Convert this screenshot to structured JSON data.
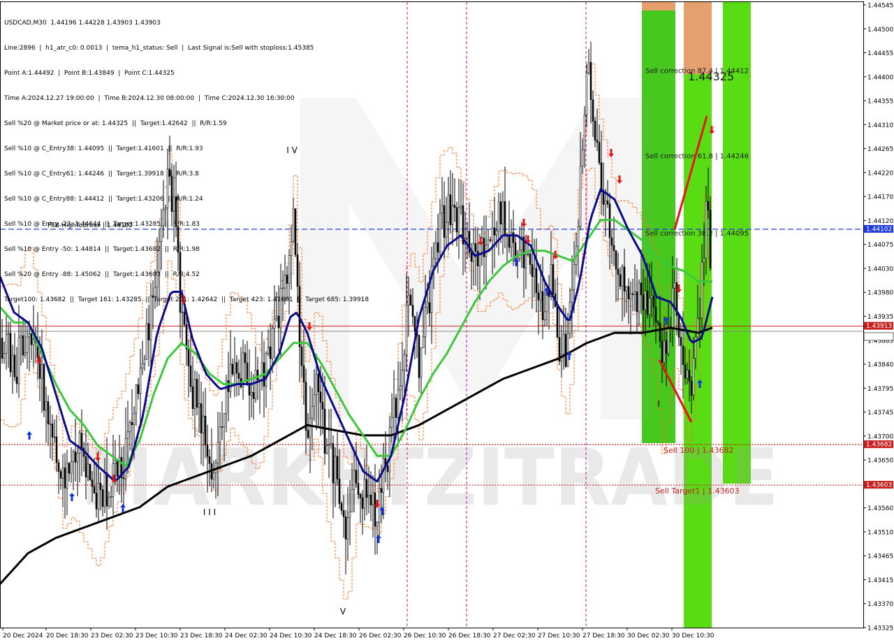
{
  "info": {
    "lines": [
      "USDCAD,M30  1.44196 1.44228 1.43903 1.43903",
      "Line:2896  |  h1_atr_c0: 0.0013  |  tema_h1_status: Sell  |  Last Signal is:Sell with stoploss:1.45385",
      "Point A:1.44492  |  Point B:1.43849  |  Point C:1.44325",
      "Time A:2024.12.27 19:00:00  |  Time B:2024.12.30 08:00:00  |  Time C:2024.12.30 16:30:00",
      "Sell %20 @ Market price or at: 1.44325  ||  Target:1.42642  ||  R/R:1.59",
      "Sell %10 @ C_Entry38: 1.44095  ||  Target:1.41601  ||  R/R:1.93",
      "Sell %10 @ C_Entry61: 1.44246  ||  Target:1.39918  ||  R/R:3.8",
      "Sell %10 @ C_Entry88: 1.44412  ||  Target:1.43206  ||  R/R:1.24",
      "Sell %10 @ Entry -23: 1.44644  ||  Target:1.43285  ||  R/R:1.83",
      "Sell %10 @ Entry -50: 1.44814  ||  Target:1.43682  ||  R/R:1.98",
      "Sell %20 @ Entry -88: 1.45062  ||  Target:1.43603  ||  R/R:4.52",
      "Target100: 1.43682  ||  Target 161: 1.43285  ||  Target 261: 1.42642  ||  Target 423: 1.41601  ||  Target 685: 1.39918"
    ]
  },
  "chart_data": {
    "type": "candlestick",
    "symbol": "USDCAD",
    "timeframe": "M30",
    "ylim": [
      1.43325,
      1.44545
    ],
    "y_ticks": [
      "1.44545",
      "1.44500",
      "1.44455",
      "1.44400",
      "1.44355",
      "1.44310",
      "1.44265",
      "1.44220",
      "1.44170",
      "1.44120",
      "1.44075",
      "1.44030",
      "1.43980",
      "1.43935",
      "1.43885",
      "1.43840",
      "1.43795",
      "1.43745",
      "1.43700",
      "1.43650",
      "1.43605",
      "1.43560",
      "1.43510",
      "1.43465",
      "1.43415",
      "1.43370",
      "1.43325"
    ],
    "x_ticks": [
      "20 Dec 2024",
      "20 Dec 18:30",
      "23 Dec 02:30",
      "23 Dec 10:30",
      "23 Dec 18:30",
      "24 Dec 02:30",
      "24 Dec 10:30",
      "24 Dec 18:30",
      "26 Dec 02:30",
      "26 Dec 10:30",
      "26 Dec 18:30",
      "27 Dec 02:30",
      "27 Dec 10:30",
      "27 Dec 18:30",
      "30 Dec 02:30",
      "30 Dec 10:30"
    ],
    "background": "#ffffff",
    "watermark": "MARKETZITRADE",
    "horizontal_lines": [
      {
        "label": "FSB-HighToBreak  |  1.44102",
        "value": 1.44102,
        "tag": "1.44102",
        "color": "#1e3cdc",
        "style": "dashed"
      },
      {
        "value": 1.43913,
        "tag": "1.43913",
        "color": "#c81e1e",
        "style": "solid"
      },
      {
        "value": 1.43903,
        "tag": "1.43903",
        "color": "#888888",
        "style": "solid"
      },
      {
        "label": "Sell 100  |  1.43682",
        "value": 1.43682,
        "tag": "1.43682",
        "color": "#c81e1e",
        "style": "dotted"
      },
      {
        "label": "Sell Target1  |  1.43603",
        "value": 1.43603,
        "tag": "1.43603",
        "color": "#c81e1e",
        "style": "dotted"
      }
    ],
    "zone_labels": [
      {
        "text": "Sell correction 87.4  |  1.44412",
        "value": 1.44412
      },
      {
        "text": "Sell correction 61.8  |  1.44246",
        "value": 1.44246
      },
      {
        "text": "Sell correction 38.2  |  1.44095",
        "value": 1.44095
      }
    ],
    "big_label": "1.44325",
    "wave_labels": [
      "I V",
      "I I I",
      "V",
      "I"
    ],
    "colors": {
      "candle": "#000000",
      "ma_fast": "#0a0a8c",
      "ma_mid": "#3cc83c",
      "ma_slow": "#000000",
      "envelope": "#ff6a1a",
      "zone_green": "#46c81e",
      "zone_lime": "#5adc14",
      "zone_orange": "#e6a06e",
      "vline": "#c8148c",
      "arrow_sell": "#e61414",
      "arrow_buy": "#1432dc"
    },
    "series": [
      {
        "name": "candles",
        "points": [
          [
            0,
            1.4389
          ],
          [
            24,
            1.4384
          ],
          [
            40,
            1.4392
          ],
          [
            55,
            1.4383
          ],
          [
            75,
            1.4372
          ],
          [
            90,
            1.4362
          ],
          [
            105,
            1.4369
          ],
          [
            125,
            1.4364
          ],
          [
            140,
            1.4357
          ],
          [
            160,
            1.4361
          ],
          [
            175,
            1.4363
          ],
          [
            190,
            1.4372
          ],
          [
            210,
            1.4388
          ],
          [
            228,
            1.4405
          ],
          [
            240,
            1.442
          ],
          [
            252,
            1.4412
          ],
          [
            260,
            1.4392
          ],
          [
            272,
            1.4381
          ],
          [
            290,
            1.4372
          ],
          [
            305,
            1.4363
          ],
          [
            318,
            1.4373
          ],
          [
            330,
            1.4382
          ],
          [
            350,
            1.4383
          ],
          [
            370,
            1.4378
          ],
          [
            390,
            1.439
          ],
          [
            410,
            1.44
          ],
          [
            420,
            1.4414
          ],
          [
            432,
            1.4383
          ],
          [
            440,
            1.437
          ],
          [
            452,
            1.4382
          ],
          [
            465,
            1.437
          ],
          [
            480,
            1.4362
          ],
          [
            495,
            1.435
          ],
          [
            510,
            1.4362
          ],
          [
            525,
            1.4357
          ],
          [
            540,
            1.4355
          ],
          [
            555,
            1.4366
          ],
          [
            570,
            1.438
          ],
          [
            585,
            1.4395
          ],
          [
            600,
            1.4385
          ],
          [
            615,
            1.4397
          ],
          [
            630,
            1.441
          ],
          [
            645,
            1.4415
          ],
          [
            660,
            1.4412
          ],
          [
            672,
            1.4408
          ],
          [
            685,
            1.4403
          ],
          [
            700,
            1.441
          ],
          [
            715,
            1.4414
          ],
          [
            730,
            1.4409
          ],
          [
            745,
            1.4406
          ],
          [
            760,
            1.4403
          ],
          [
            775,
            1.4395
          ],
          [
            790,
            1.44
          ],
          [
            800,
            1.4388
          ],
          [
            812,
            1.4385
          ],
          [
            822,
            1.4405
          ],
          [
            832,
            1.442
          ],
          [
            842,
            1.4442
          ],
          [
            852,
            1.443
          ],
          [
            862,
            1.442
          ],
          [
            872,
            1.4412
          ],
          [
            882,
            1.4402
          ],
          [
            895,
            1.44
          ],
          [
            910,
            1.4398
          ],
          [
            925,
            1.4397
          ],
          [
            938,
            1.4395
          ],
          [
            948,
            1.4382
          ],
          [
            958,
            1.4393
          ],
          [
            966,
            1.4398
          ],
          [
            975,
            1.439
          ],
          [
            985,
            1.4378
          ],
          [
            995,
            1.4385
          ],
          [
            1005,
            1.44
          ],
          [
            1012,
            1.4418
          ],
          [
            1020,
            1.439
          ]
        ]
      },
      {
        "name": "ma_fast",
        "points": [
          [
            0,
            1.4401
          ],
          [
            20,
            1.4394
          ],
          [
            40,
            1.4392
          ],
          [
            60,
            1.4387
          ],
          [
            80,
            1.4378
          ],
          [
            100,
            1.4369
          ],
          [
            120,
            1.4367
          ],
          [
            140,
            1.4364
          ],
          [
            165,
            1.4361
          ],
          [
            185,
            1.4364
          ],
          [
            205,
            1.4374
          ],
          [
            225,
            1.439
          ],
          [
            245,
            1.4398
          ],
          [
            260,
            1.4398
          ],
          [
            275,
            1.4389
          ],
          [
            295,
            1.4382
          ],
          [
            315,
            1.4379
          ],
          [
            340,
            1.438
          ],
          [
            360,
            1.438
          ],
          [
            380,
            1.4381
          ],
          [
            400,
            1.4386
          ],
          [
            415,
            1.4393
          ],
          [
            425,
            1.4394
          ],
          [
            440,
            1.439
          ],
          [
            460,
            1.4381
          ],
          [
            480,
            1.4375
          ],
          [
            500,
            1.4369
          ],
          [
            520,
            1.4363
          ],
          [
            540,
            1.4361
          ],
          [
            560,
            1.4366
          ],
          [
            580,
            1.4378
          ],
          [
            600,
            1.4393
          ],
          [
            620,
            1.4402
          ],
          [
            640,
            1.4407
          ],
          [
            660,
            1.4409
          ],
          [
            680,
            1.4405
          ],
          [
            700,
            1.4406
          ],
          [
            720,
            1.4409
          ],
          [
            740,
            1.4409
          ],
          [
            760,
            1.4407
          ],
          [
            780,
            1.44
          ],
          [
            800,
            1.4395
          ],
          [
            815,
            1.4392
          ],
          [
            830,
            1.44
          ],
          [
            845,
            1.4412
          ],
          [
            860,
            1.4418
          ],
          [
            880,
            1.4416
          ],
          [
            900,
            1.441
          ],
          [
            920,
            1.4405
          ],
          [
            940,
            1.4397
          ],
          [
            960,
            1.4396
          ],
          [
            975,
            1.4393
          ],
          [
            990,
            1.4388
          ],
          [
            1005,
            1.4389
          ],
          [
            1020,
            1.4397
          ]
        ]
      },
      {
        "name": "ma_mid",
        "points": [
          [
            0,
            1.4395
          ],
          [
            20,
            1.4392
          ],
          [
            40,
            1.4392
          ],
          [
            60,
            1.4386
          ],
          [
            80,
            1.438
          ],
          [
            100,
            1.4375
          ],
          [
            120,
            1.4372
          ],
          [
            140,
            1.4368
          ],
          [
            160,
            1.4366
          ],
          [
            180,
            1.4364
          ],
          [
            200,
            1.4369
          ],
          [
            220,
            1.4378
          ],
          [
            240,
            1.4385
          ],
          [
            260,
            1.4388
          ],
          [
            280,
            1.4386
          ],
          [
            300,
            1.4382
          ],
          [
            320,
            1.438
          ],
          [
            340,
            1.438
          ],
          [
            360,
            1.4381
          ],
          [
            380,
            1.4382
          ],
          [
            400,
            1.4385
          ],
          [
            420,
            1.4388
          ],
          [
            440,
            1.4388
          ],
          [
            460,
            1.4384
          ],
          [
            480,
            1.4379
          ],
          [
            500,
            1.4374
          ],
          [
            520,
            1.437
          ],
          [
            540,
            1.4366
          ],
          [
            560,
            1.4366
          ],
          [
            580,
            1.4371
          ],
          [
            600,
            1.4377
          ],
          [
            620,
            1.4382
          ],
          [
            640,
            1.4386
          ],
          [
            660,
            1.4391
          ],
          [
            680,
            1.4396
          ],
          [
            700,
            1.44
          ],
          [
            720,
            1.4403
          ],
          [
            740,
            1.4405
          ],
          [
            760,
            1.4406
          ],
          [
            780,
            1.4406
          ],
          [
            800,
            1.4405
          ],
          [
            820,
            1.4404
          ],
          [
            840,
            1.4408
          ],
          [
            860,
            1.4412
          ],
          [
            880,
            1.4412
          ],
          [
            900,
            1.441
          ],
          [
            920,
            1.4408
          ],
          [
            940,
            1.4405
          ],
          [
            960,
            1.4403
          ],
          [
            980,
            1.4402
          ],
          [
            1000,
            1.44
          ],
          [
            1020,
            1.44
          ]
        ]
      },
      {
        "name": "ma_slow",
        "points": [
          [
            0,
            1.4341
          ],
          [
            40,
            1.4347
          ],
          [
            80,
            1.435
          ],
          [
            120,
            1.4352
          ],
          [
            160,
            1.4354
          ],
          [
            200,
            1.4356
          ],
          [
            240,
            1.436
          ],
          [
            280,
            1.4362
          ],
          [
            320,
            1.4364
          ],
          [
            360,
            1.4366
          ],
          [
            400,
            1.4369
          ],
          [
            440,
            1.4372
          ],
          [
            480,
            1.4371
          ],
          [
            520,
            1.437
          ],
          [
            560,
            1.437
          ],
          [
            600,
            1.4372
          ],
          [
            640,
            1.4375
          ],
          [
            680,
            1.4378
          ],
          [
            720,
            1.4381
          ],
          [
            760,
            1.4383
          ],
          [
            800,
            1.4385
          ],
          [
            840,
            1.4388
          ],
          [
            880,
            1.439
          ],
          [
            920,
            1.439
          ],
          [
            960,
            1.4391
          ],
          [
            1000,
            1.439
          ],
          [
            1020,
            1.4391
          ]
        ]
      }
    ]
  }
}
